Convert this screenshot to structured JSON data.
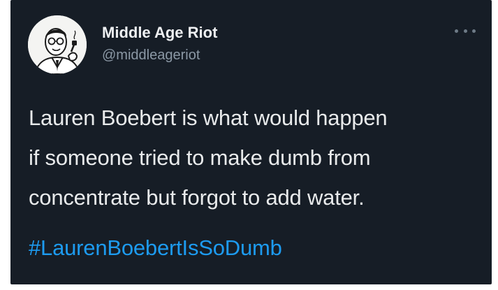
{
  "tweet": {
    "display_name": "Middle Age Riot",
    "handle": "@middleageriot",
    "more_icon": "more-horizontal-icon",
    "text_lines": [
      "Lauren Boebert is what would happen",
      "if someone tried to make dumb from",
      "concentrate but forgot to add water."
    ],
    "hashtag": "#LaurenBoebertIsSoDumb"
  },
  "colors": {
    "background": "#161d26",
    "text": "#e8eaeb",
    "secondary_text": "#8b98a5",
    "link": "#1d9bf0"
  }
}
